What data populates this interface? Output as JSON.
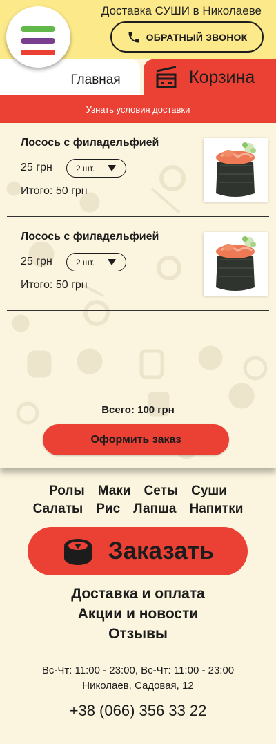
{
  "header": {
    "title": "Доставка СУШИ в Николаеве",
    "callback_label": "ОБРАТНЫЙ ЗВОНОК",
    "menu_colors": [
      "#62b84a",
      "#7a3e8e",
      "#ea4134"
    ]
  },
  "tabs": {
    "home_label": "Главная",
    "cart_label": "Корзина"
  },
  "delivery_conditions_label": "Узнать условия доставки",
  "cart": {
    "items": [
      {
        "name": "Лосось с филадельфией",
        "price": "25 грн",
        "qty": "2 шт.",
        "total": "Итого: 50 грн"
      },
      {
        "name": "Лосось с филадельфией",
        "price": "25 грн",
        "qty": "2 шт.",
        "total": "Итого: 50 грн"
      }
    ],
    "grand_total": "Всего: 100 грн",
    "checkout_label": "Оформить заказ"
  },
  "footer": {
    "categories_row1": [
      "Ролы",
      "Маки",
      "Сеты",
      "Суши"
    ],
    "categories_row2": [
      "Салаты",
      "Рис",
      "Лапша",
      "Напитки"
    ],
    "order_label": "Заказать",
    "links": [
      "Доставка и оплата",
      "Акции и новости",
      "Отзывы"
    ],
    "hours": "Вс-Чт:  11:00 - 23:00, Вс-Чт:  11:00 - 23:00",
    "address": "Николаев, Садовая, 12",
    "phone": "+38 (066) 356 33 22"
  },
  "colors": {
    "accent": "#ea4134",
    "header_bg": "#fbe98a",
    "page_bg": "#fbf5df"
  },
  "icons": [
    "menu-icon",
    "phone-icon",
    "cart-icon",
    "chevron-down-icon",
    "sushi-roll-icon"
  ]
}
